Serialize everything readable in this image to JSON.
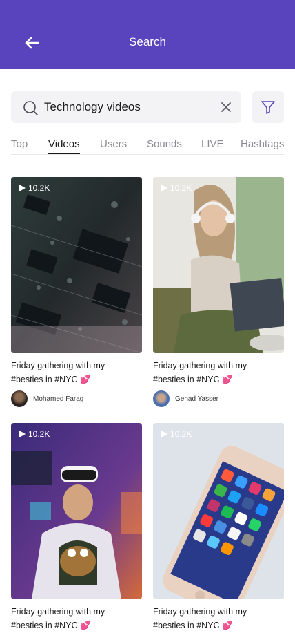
{
  "header": {
    "title": "Search",
    "back_icon": "arrow-left-icon",
    "bg_color": "#5a44bd"
  },
  "search": {
    "value": "Technology videos",
    "placeholder": "Search",
    "search_icon": "search-icon",
    "clear_icon": "close-icon",
    "filter_icon": "filter-icon"
  },
  "tabs": [
    {
      "label": "Top",
      "active": false
    },
    {
      "label": "Videos",
      "active": true
    },
    {
      "label": "Users",
      "active": false
    },
    {
      "label": "Sounds",
      "active": false
    },
    {
      "label": "LIVE",
      "active": false
    },
    {
      "label": "Hashtags",
      "active": false
    }
  ],
  "videos": [
    {
      "views": "10.2K",
      "caption_line1": "Friday gathering with my",
      "caption_line2": "#besties in #NYC 💕",
      "author": "Mohamed Farag",
      "thumb": "circuit-board"
    },
    {
      "views": "10.2K",
      "caption_line1": "Friday gathering with my",
      "caption_line2": "#besties in #NYC 💕",
      "author": "Gehad Yasser",
      "thumb": "woman-headphones-laptop"
    },
    {
      "views": "10.2K",
      "caption_line1": "Friday gathering with my",
      "caption_line2": "#besties in #NYC 💕",
      "author": "",
      "thumb": "boy-vr-headset"
    },
    {
      "views": "10.2K",
      "caption_line1": "Friday gathering with my",
      "caption_line2": "#besties in #NYC 💕",
      "author": "",
      "thumb": "smartphone-home-screen"
    }
  ]
}
